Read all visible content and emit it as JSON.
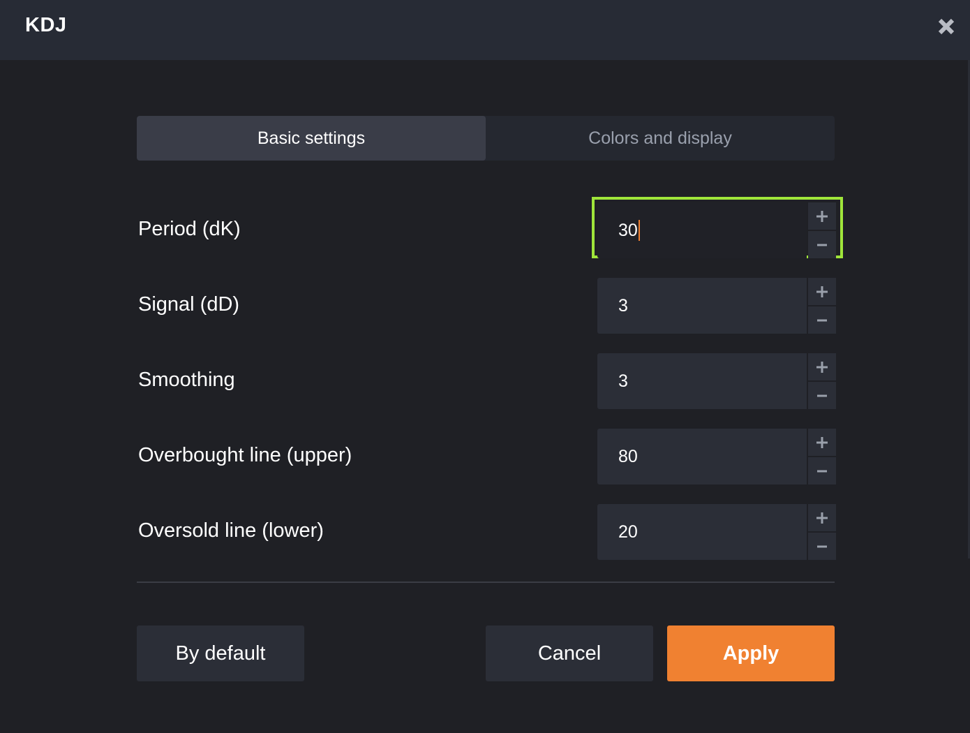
{
  "header": {
    "title": "KDJ",
    "close_icon": "close-icon"
  },
  "tabs": [
    {
      "label": "Basic settings",
      "active": true
    },
    {
      "label": "Colors and display",
      "active": false
    }
  ],
  "settings": [
    {
      "label": "Period (dK)",
      "value": "30",
      "focused": true
    },
    {
      "label": "Signal (dD)",
      "value": "3",
      "focused": false
    },
    {
      "label": "Smoothing",
      "value": "3",
      "focused": false
    },
    {
      "label": "Overbought line (upper)",
      "value": "80",
      "focused": false
    },
    {
      "label": "Oversold line (lower)",
      "value": "20",
      "focused": false
    }
  ],
  "footer": {
    "default_label": "By default",
    "cancel_label": "Cancel",
    "apply_label": "Apply"
  },
  "colors": {
    "focus_outline": "#9fe53a",
    "accent": "#f08131",
    "caret": "#f07f30"
  }
}
